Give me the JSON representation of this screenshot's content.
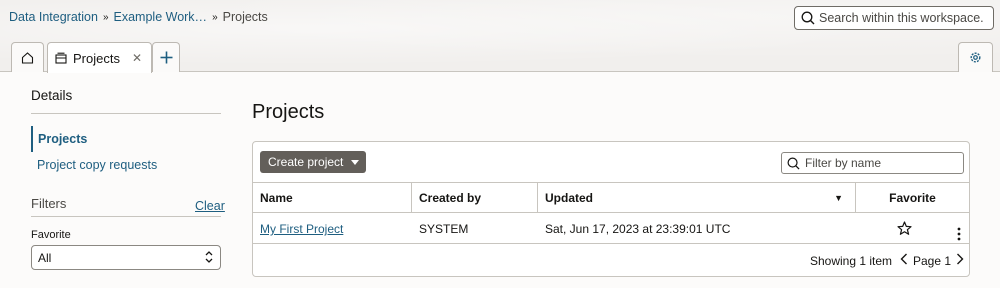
{
  "breadcrumb": {
    "items": [
      "Data Integration",
      "Example Work…"
    ],
    "current": "Projects"
  },
  "search": {
    "placeholder": "Search within this workspace."
  },
  "tabs": {
    "home_icon": "home-icon",
    "active_label": "Projects",
    "add_icon": "plus-icon",
    "settings_icon": "gear-icon"
  },
  "sidebar": {
    "title": "Details",
    "items": [
      {
        "label": "Projects",
        "active": true
      },
      {
        "label": "Project copy requests",
        "active": false
      }
    ],
    "filters_title": "Filters",
    "clear_label": "Clear",
    "favorite_label": "Favorite",
    "favorite_value": "All"
  },
  "main": {
    "title": "Projects",
    "create_label": "Create project",
    "filter_placeholder": "Filter by name",
    "columns": {
      "name": "Name",
      "created_by": "Created by",
      "updated": "Updated",
      "favorite": "Favorite"
    },
    "rows": [
      {
        "name": "My First Project",
        "created_by": "SYSTEM",
        "updated": "Sat, Jun 17, 2023 at 23:39:01 UTC"
      }
    ],
    "showing": "Showing 1 item",
    "page": "Page 1"
  },
  "colors": {
    "link": "#1e5e80",
    "button_bg": "#635f5a",
    "border": "#c8c5bf"
  }
}
